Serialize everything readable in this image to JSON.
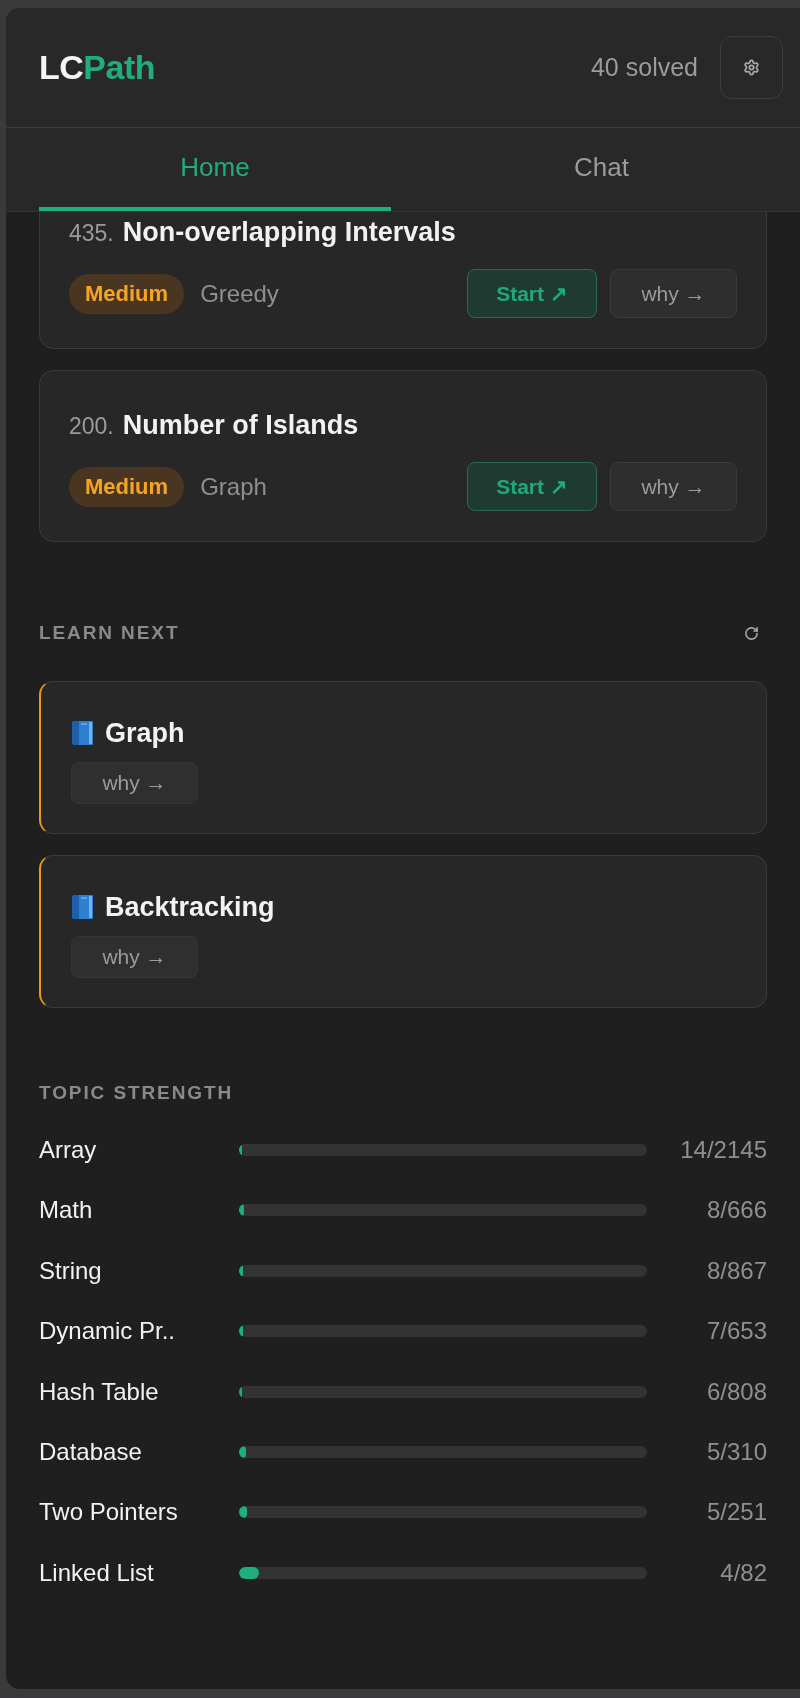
{
  "header": {
    "logo": {
      "prefix": "LC",
      "accent": "Path"
    },
    "solved": "40 solved"
  },
  "tabs": [
    {
      "label": "Home",
      "selected": true
    },
    {
      "label": "Chat",
      "selected": false
    }
  ],
  "problems": [
    {
      "number": "435.",
      "title": "Non-overlapping Intervals",
      "difficulty": "Medium",
      "topic": "Greedy",
      "start": "Start ↗",
      "why": "why →"
    },
    {
      "number": "200.",
      "title": "Number of Islands",
      "difficulty": "Medium",
      "topic": "Graph",
      "start": "Start ↗",
      "why": "why →"
    }
  ],
  "learn_next": {
    "heading": "LEARN NEXT",
    "items": [
      {
        "topic": "Graph",
        "why": "why →"
      },
      {
        "topic": "Backtracking",
        "why": "why →"
      }
    ]
  },
  "topic_strength": {
    "heading": "TOPIC STRENGTH",
    "topics": [
      {
        "name": "Array",
        "level": 0.0065,
        "count": "14/2145"
      },
      {
        "name": "Math",
        "level": 0.012,
        "count": "8/666"
      },
      {
        "name": "String",
        "level": 0.0092,
        "count": "8/867"
      },
      {
        "name": "Dynamic Pr..",
        "level": 0.0107,
        "count": "7/653"
      },
      {
        "name": "Hash Table",
        "level": 0.0074,
        "count": "6/808"
      },
      {
        "name": "Database",
        "level": 0.0161,
        "count": "5/310"
      },
      {
        "name": "Two Pointers",
        "level": 0.0199,
        "count": "5/251"
      },
      {
        "name": "Linked List",
        "level": 0.0488,
        "count": "4/82"
      }
    ]
  }
}
